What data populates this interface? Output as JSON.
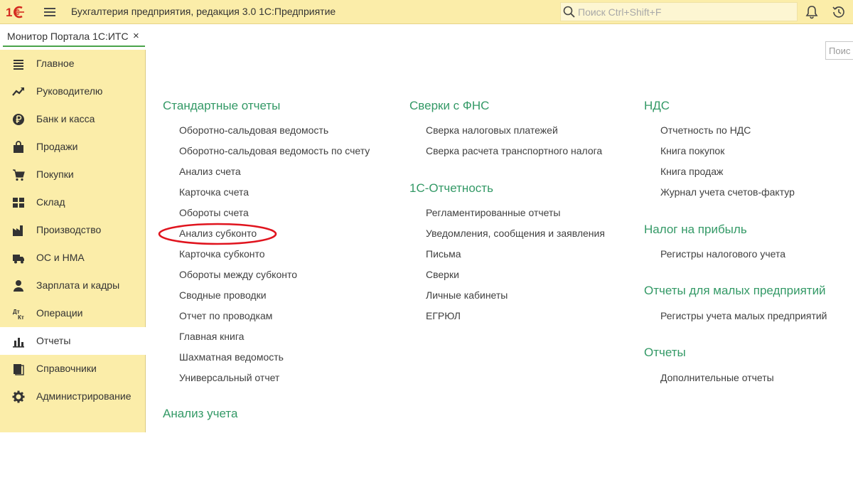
{
  "header": {
    "app_title": "Бухгалтерия предприятия, редакция 3.0 1С:Предприятие",
    "search_placeholder": "Поиск Ctrl+Shift+F",
    "logo_icon": "1c-logo-icon",
    "menu_icon": "hamburger-menu-icon",
    "bell_icon": "bell-icon",
    "history_icon": "history-icon"
  },
  "tabs": [
    {
      "label": "Монитор Портала 1С:ИТС",
      "close": "×"
    }
  ],
  "sidebar": {
    "items": [
      {
        "label": "Главное",
        "icon": "list-icon"
      },
      {
        "label": "Руководителю",
        "icon": "trend-up-icon"
      },
      {
        "label": "Банк и касса",
        "icon": "ruble-coin-icon"
      },
      {
        "label": "Продажи",
        "icon": "shopping-bag-icon"
      },
      {
        "label": "Покупки",
        "icon": "shopping-cart-icon"
      },
      {
        "label": "Склад",
        "icon": "warehouse-icon"
      },
      {
        "label": "Производство",
        "icon": "factory-icon"
      },
      {
        "label": "ОС и НМА",
        "icon": "truck-icon"
      },
      {
        "label": "Зарплата и кадры",
        "icon": "person-icon"
      },
      {
        "label": "Операции",
        "icon": "debit-credit-icon"
      },
      {
        "label": "Отчеты",
        "icon": "bar-chart-icon",
        "active": true
      },
      {
        "label": "Справочники",
        "icon": "books-icon"
      },
      {
        "label": "Администрирование",
        "icon": "gear-icon"
      }
    ]
  },
  "main": {
    "search_placeholder": "Поис",
    "columns": [
      {
        "sections": [
          {
            "title": "Стандартные отчеты",
            "items": [
              "Оборотно-сальдовая ведомость",
              "Оборотно-сальдовая ведомость по счету",
              "Анализ счета",
              "Карточка счета",
              "Обороты счета",
              "Анализ субконто",
              "Карточка субконто",
              "Обороты между субконто",
              "Сводные проводки",
              "Отчет по проводкам",
              "Главная книга",
              "Шахматная ведомость",
              "Универсальный отчет"
            ]
          },
          {
            "title": "Анализ учета",
            "items": []
          }
        ]
      },
      {
        "sections": [
          {
            "title": "Сверки с ФНС",
            "items": [
              "Сверка налоговых платежей",
              "Сверка расчета транспортного налога"
            ]
          },
          {
            "title": "1С-Отчетность",
            "items": [
              "Регламентированные отчеты",
              "Уведомления, сообщения и заявления",
              "Письма",
              "Сверки",
              "Личные кабинеты",
              "ЕГРЮЛ"
            ]
          }
        ]
      },
      {
        "sections": [
          {
            "title": "НДС",
            "items": [
              "Отчетность по НДС",
              "Книга покупок",
              "Книга продаж",
              "Журнал учета счетов-фактур"
            ]
          },
          {
            "title": "Налог на прибыль",
            "items": [
              "Регистры налогового учета"
            ]
          },
          {
            "title": "Отчеты для малых предприятий",
            "items": [
              "Регистры учета малых предприятий"
            ]
          },
          {
            "title": "Отчеты",
            "items": [
              "Дополнительные отчеты"
            ]
          }
        ]
      }
    ],
    "highlighted_item": "Анализ субконто"
  },
  "colors": {
    "topbar_bg": "#fbeda9",
    "section_title": "#339966",
    "highlight": "#e0141e",
    "tab_underline": "#4aa34a"
  }
}
